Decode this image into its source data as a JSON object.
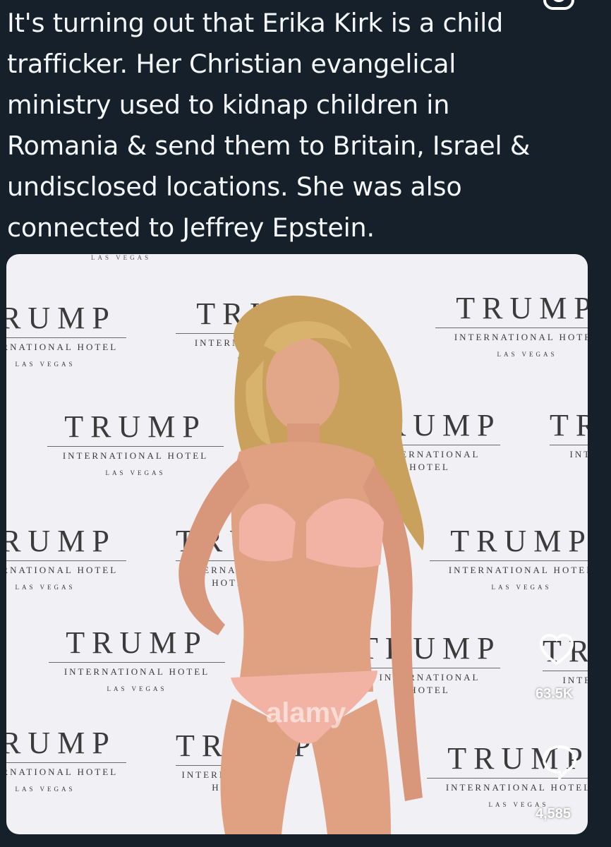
{
  "post": {
    "text": "It's turning out that Erika Kirk is a child\ntrafficker. Her Christian evangelical\nministry used to kidnap children in\nRomania & send them to Britain, Israel &\nundisclosed locations. She was also\nconnected to Jeffrey Epstein."
  },
  "photo": {
    "backdrop_logo": {
      "name": "TRUMP",
      "subtitle": "INTERNATIONAL HOTEL",
      "city": "LAS VEGAS"
    },
    "watermark": "alamy",
    "likes_count": "63.5K",
    "views_count": "4,585"
  },
  "icons": {
    "like": "heart-icon",
    "views": "chat-bubble-icon",
    "corner": "camera-icon"
  },
  "colors": {
    "background": "#15202b",
    "text": "#f5f8fa"
  }
}
